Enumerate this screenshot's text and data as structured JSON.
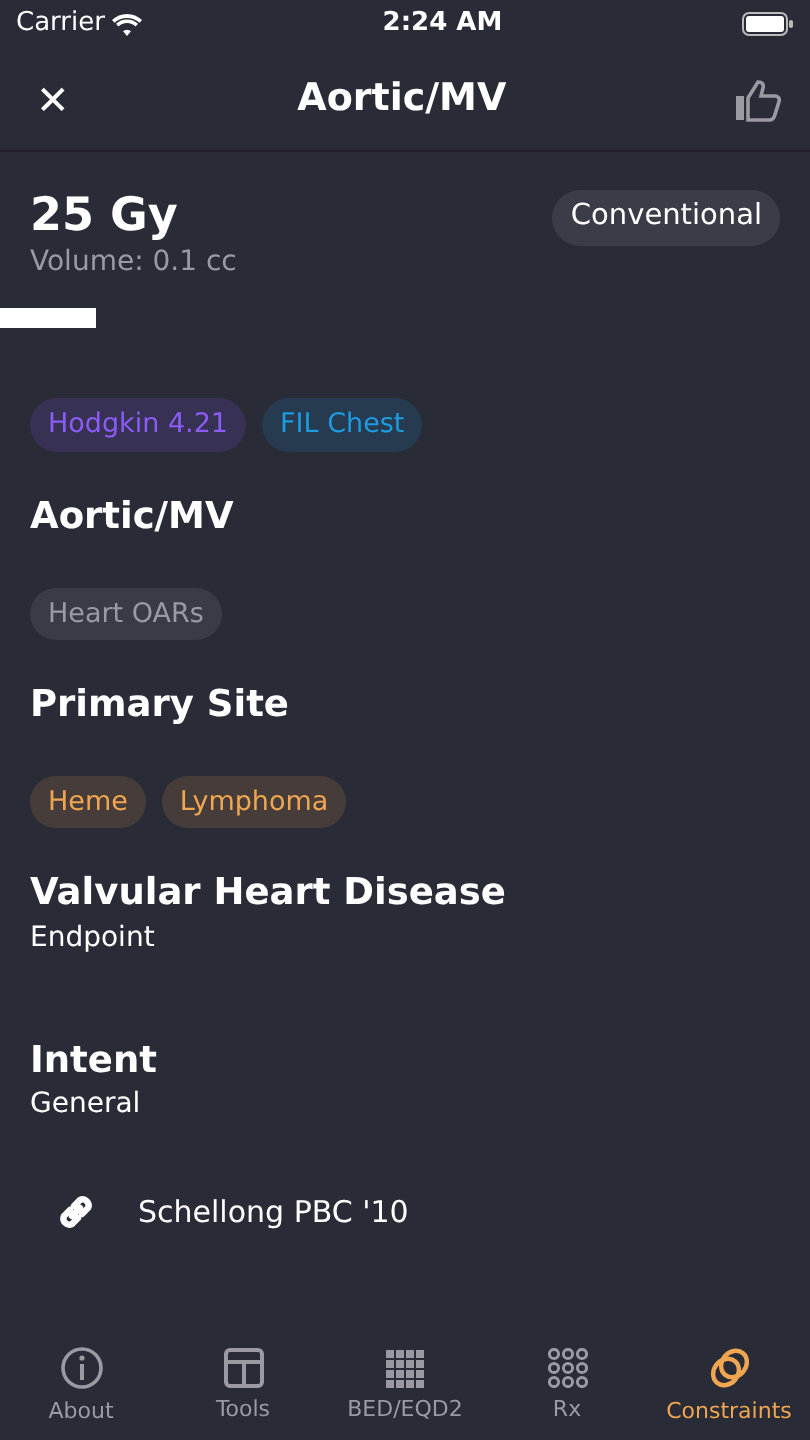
{
  "status_bar": {
    "carrier": "Carrier",
    "time": "2:24 AM"
  },
  "header": {
    "title": "Aortic/MV",
    "close": "✕"
  },
  "dose": {
    "value": "25 Gy",
    "volume": "Volume: 0.1 cc",
    "badge": "Conventional"
  },
  "source_tags": [
    {
      "label": "Hodgkin 4.21",
      "color": "#8b5cf6"
    },
    {
      "label": "FIL Chest",
      "color": "#1e9be0"
    }
  ],
  "sections": [
    {
      "kind": "tags",
      "title": "Aortic/MV",
      "tags": [
        {
          "label": "Heart OARs",
          "color": "#9a9ba2"
        }
      ]
    },
    {
      "kind": "tags",
      "title": "Primary Site",
      "tags": [
        {
          "label": "Heme",
          "color": "#f0a650"
        },
        {
          "label": "Lymphoma",
          "color": "#f0a650"
        }
      ]
    },
    {
      "kind": "text",
      "title": "Valvular Heart Disease",
      "subtitle": "Endpoint"
    },
    {
      "kind": "text",
      "title": "Intent",
      "subtitle": "General"
    }
  ],
  "reference": {
    "label": "Schellong PBC '10"
  },
  "tabs": [
    {
      "label": "About",
      "selected": false
    },
    {
      "label": "Tools",
      "selected": false
    },
    {
      "label": "BED/EQD2",
      "selected": false
    },
    {
      "label": "Rx",
      "selected": false
    },
    {
      "label": "Constraints",
      "selected": true
    }
  ]
}
